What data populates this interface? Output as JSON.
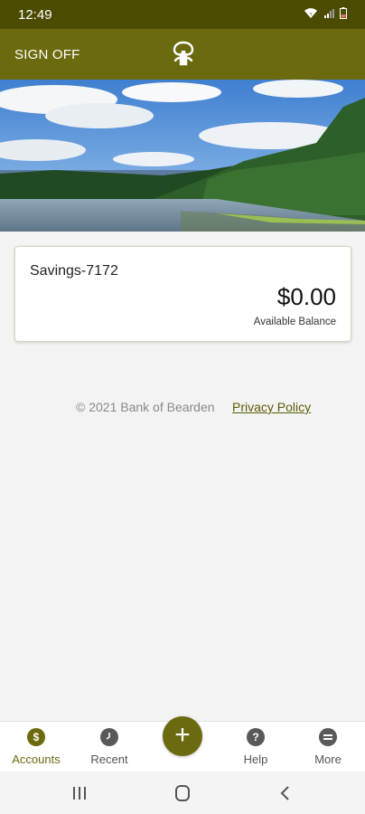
{
  "status_bar": {
    "time": "12:49",
    "icons": [
      "wifi-icon",
      "signal-icon",
      "battery-icon"
    ]
  },
  "header": {
    "sign_off_label": "SIGN OFF",
    "logo": "bank-logo-icon"
  },
  "account": {
    "name": "Savings-7172",
    "balance": "$0.00",
    "balance_label": "Available Balance"
  },
  "footer": {
    "copyright": "© 2021 Bank of Bearden",
    "privacy_label": "Privacy Policy"
  },
  "bottom_nav": {
    "items": [
      {
        "label": "Accounts",
        "icon": "accounts-icon",
        "active": true
      },
      {
        "label": "Recent",
        "icon": "clock-icon",
        "active": false
      },
      {
        "label": "Help",
        "icon": "help-icon",
        "active": false
      },
      {
        "label": "More",
        "icon": "more-icon",
        "active": false
      }
    ],
    "fab": {
      "icon": "plus-icon",
      "symbol": "+"
    }
  },
  "system_nav": [
    "recents-icon",
    "home-icon",
    "back-icon"
  ],
  "colors": {
    "brand": "#6b6a0e",
    "brand_dark": "#4b4c02",
    "link": "#5d5b06"
  }
}
